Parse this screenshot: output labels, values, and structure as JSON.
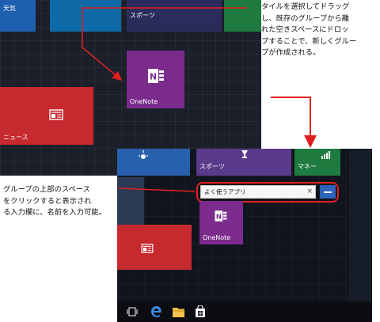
{
  "top_screenshot": {
    "tiles": {
      "weather_label": "天気",
      "sports_label": "スポーツ",
      "onenote_label": "OneNote",
      "news_label": "ニュース"
    }
  },
  "bottom_screenshot": {
    "tiles": {
      "sports_label": "スポーツ",
      "money_label": "マネー",
      "onenote_label": "OneNote"
    },
    "group_name_input": {
      "value": "よく使うアプリ",
      "clear_glyph": "×"
    },
    "taskbar": {
      "icons": [
        "task-view-icon",
        "edge-icon",
        "file-explorer-icon",
        "store-icon"
      ]
    }
  },
  "callouts": {
    "top_right": [
      "タイルを選択してドラッグ",
      "し、既存のグループから離",
      "れた空きスペースにドロッ",
      "プすることで、新しくグルー",
      "プが作成される。"
    ],
    "left": [
      "グループの上部のスペース",
      "をクリックすると表示され",
      "る入力欄に、名前を入力可能。"
    ]
  },
  "colors": {
    "accent_red": "#e02020",
    "onenote_purple": "#7a2b8c",
    "news_red": "#c62a2f",
    "tile_blue": "#2860ad",
    "money_green": "#1e7a3e"
  }
}
